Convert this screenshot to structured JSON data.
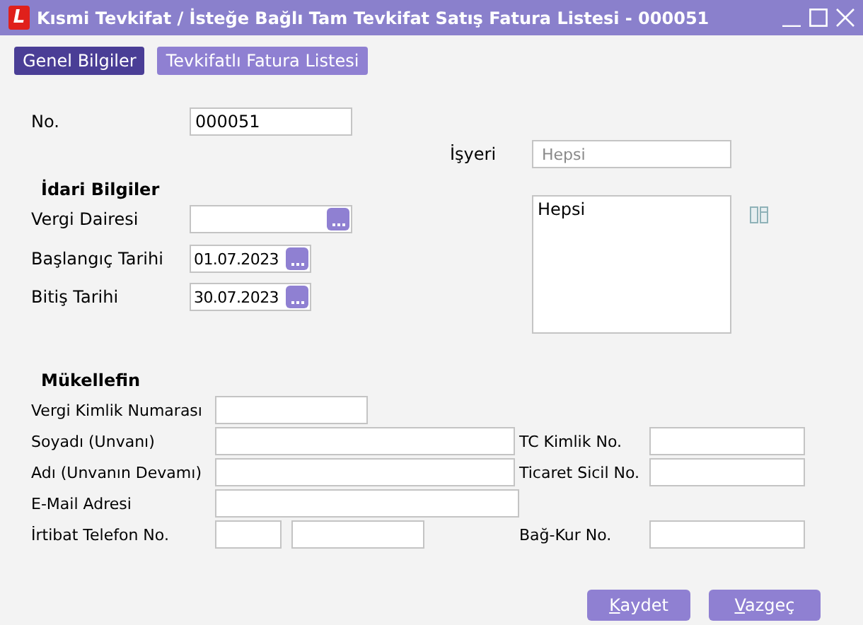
{
  "window": {
    "logo": "L",
    "title": "Kısmi Tevkifat / İsteğe Bağlı Tam Tevkifat Satış Fatura Listesi - 000051"
  },
  "tabs": [
    {
      "label": "Genel Bilgiler",
      "selected": true
    },
    {
      "label": "Tevkifatlı Fatura Listesi",
      "selected": false
    }
  ],
  "number": {
    "label": "No.",
    "value": "000051"
  },
  "workplace": {
    "label": "İşyeri",
    "placeholder": "Hepsi",
    "list_items": [
      "Hepsi"
    ]
  },
  "admin": {
    "title": "İdari Bilgiler",
    "fields": [
      {
        "label": "Vergi Dairesi",
        "kind": "lookup"
      },
      {
        "label": "Başlangıç Tarihi",
        "kind": "date",
        "value": "01.07.2023"
      },
      {
        "label": "Bitiş Tarihi",
        "kind": "date",
        "value": "30.07.2023"
      }
    ]
  },
  "taxpayer": {
    "title": "Mükellefin",
    "rows": [
      {
        "label": "Vergi Kimlik Numarası",
        "kind": "short"
      },
      {
        "label": "Soyadı (Unvanı)",
        "kind": "wide",
        "right_label": "TC Kimlik No."
      },
      {
        "label": "Adı (Unvanın Devamı)",
        "kind": "wide",
        "right_label": "Ticaret Sicil No."
      },
      {
        "label": "E-Mail Adresi",
        "kind": "long"
      },
      {
        "label": "İrtibat Telefon No.",
        "kind": "phone",
        "right_label": "Bağ-Kur No."
      }
    ]
  },
  "buttons": [
    {
      "label": "Kaydet"
    },
    {
      "label": "Vazgeç"
    }
  ]
}
